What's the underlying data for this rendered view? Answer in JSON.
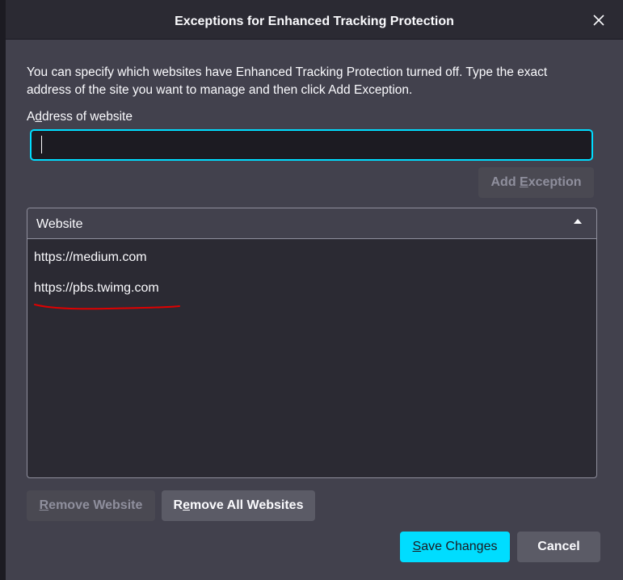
{
  "dialog": {
    "title": "Exceptions for Enhanced Tracking Protection",
    "close_icon": "close-icon"
  },
  "description": "You can specify which websites have Enhanced Tracking Protection turned off. Type the exact address of the site you want to manage and then click Add Exception.",
  "address": {
    "label_pre": "A",
    "label_key": "d",
    "label_post": "dress of website",
    "value": "",
    "placeholder": ""
  },
  "add_button": {
    "pre": "Add ",
    "key": "E",
    "post": "xception",
    "enabled": false
  },
  "table": {
    "column_header": "Website",
    "sort_icon": "sort-ascending-icon",
    "rows": [
      "https://medium.com",
      "https://pbs.twimg.com"
    ],
    "annotation_color": "#e00000"
  },
  "remove_button": {
    "pre": "",
    "key": "R",
    "post": "emove Website",
    "enabled": false
  },
  "remove_all_button": {
    "pre": "R",
    "key": "e",
    "post": "move All Websites"
  },
  "save_button": {
    "pre": "",
    "key": "S",
    "post": "ave Changes"
  },
  "cancel_button": {
    "label": "Cancel"
  },
  "colors": {
    "accent": "#00ddff",
    "dialog_bg": "#42414d",
    "list_bg": "#2b2a33",
    "text": "#fbfbfe",
    "disabled_text": "#8f8f9d"
  }
}
